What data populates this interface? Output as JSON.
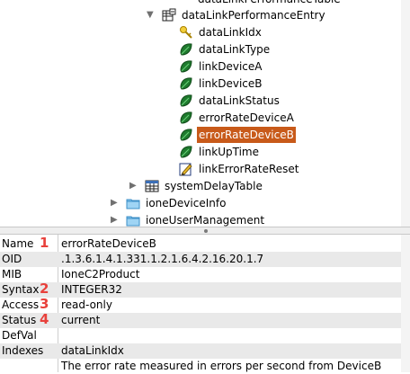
{
  "tree": {
    "nodes": [
      {
        "label": "dataLinkPerformanceTable",
        "icon": "table-icon"
      },
      {
        "label": "dataLinkPerformanceEntry",
        "icon": "entry-icon"
      },
      {
        "label": "dataLinkIdx",
        "icon": "key-icon"
      },
      {
        "label": "dataLinkType",
        "icon": "leaf-icon"
      },
      {
        "label": "linkDeviceA",
        "icon": "leaf-icon"
      },
      {
        "label": "linkDeviceB",
        "icon": "leaf-icon"
      },
      {
        "label": "dataLinkStatus",
        "icon": "leaf-icon"
      },
      {
        "label": "errorRateDeviceA",
        "icon": "leaf-icon"
      },
      {
        "label": "errorRateDeviceB",
        "icon": "leaf-icon",
        "selected": true
      },
      {
        "label": "linkUpTime",
        "icon": "leaf-icon"
      },
      {
        "label": "linkErrorRateReset",
        "icon": "edit-icon"
      },
      {
        "label": "systemDelayTable",
        "icon": "table-icon"
      },
      {
        "label": "ioneDeviceInfo",
        "icon": "folder-icon"
      },
      {
        "label": "ioneUserManagement",
        "icon": "folder-icon"
      }
    ]
  },
  "properties": {
    "rows": [
      {
        "name": "Name",
        "num": "1",
        "value": "errorRateDeviceB"
      },
      {
        "name": "OID",
        "num": "",
        "value": ".1.3.6.1.4.1.331.1.2.1.6.4.2.16.20.1.7"
      },
      {
        "name": "MIB",
        "num": "",
        "value": "IoneC2Product"
      },
      {
        "name": "Syntax",
        "num": "2",
        "value": "INTEGER32"
      },
      {
        "name": "Access",
        "num": "3",
        "value": "read-only"
      },
      {
        "name": "Status",
        "num": "4",
        "value": "current"
      },
      {
        "name": "DefVal",
        "num": "",
        "value": ""
      },
      {
        "name": "Indexes",
        "num": "",
        "value": "dataLinkIdx"
      }
    ],
    "description": "The error rate measured in errors per second from DeviceB"
  },
  "colors": {
    "selection": "#c85a1a",
    "annotation": "#e8413c",
    "leaf": "#1f7a2e",
    "folder": "#7fc3ec"
  }
}
